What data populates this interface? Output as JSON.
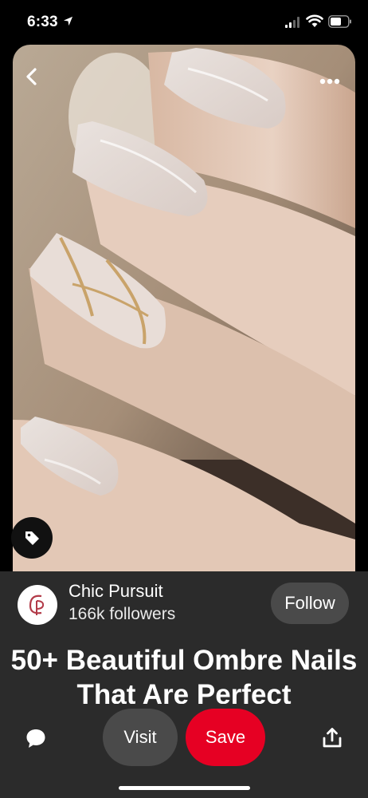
{
  "status_bar": {
    "time": "6:33",
    "icons": [
      "location-arrow-icon",
      "cellular-signal-icon",
      "wifi-icon",
      "battery-icon"
    ]
  },
  "pin": {
    "image_description_icon": "nail-photo",
    "back_icon": "chevron-left-icon",
    "more_icon": "more-horizontal-icon",
    "tag_icon": "tag-icon",
    "title": "50+ Beautiful Ombre Nails That Are Perfect"
  },
  "creator": {
    "name": "Chic Pursuit",
    "followers": "166k followers",
    "follow_label": "Follow",
    "avatar_text": "CP"
  },
  "actions": {
    "comment_icon": "comment-icon",
    "visit_label": "Visit",
    "save_label": "Save",
    "share_icon": "share-icon"
  },
  "colors": {
    "background": "#000000",
    "panel": "#2b2b2b",
    "button_gray": "#4a4a4a",
    "save_red": "#e60023"
  }
}
